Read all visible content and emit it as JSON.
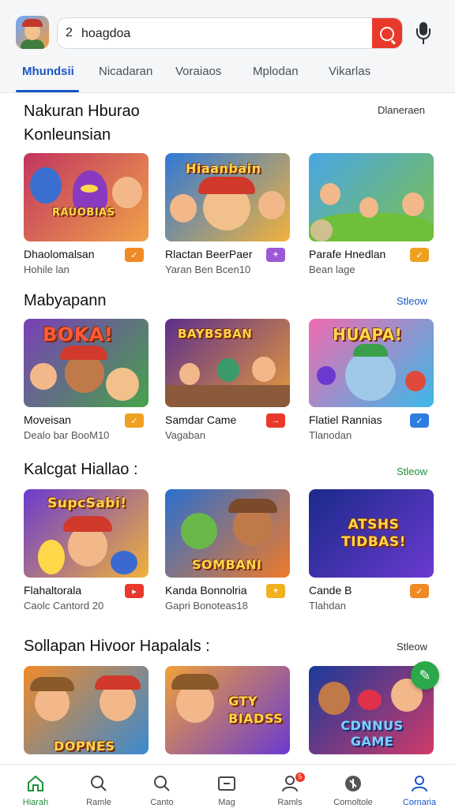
{
  "header": {
    "search": {
      "prefix": "2",
      "value": "hoagdoa"
    },
    "tabs": [
      {
        "label": "Mhundsii",
        "active": true
      },
      {
        "label": "Nicadaran"
      },
      {
        "label": "Voraiaos"
      },
      {
        "label": "Mplodan"
      },
      {
        "label": "Vikarlas"
      }
    ]
  },
  "sections": [
    {
      "title_line1": "Nakuran Hburao",
      "title_line2": "Konleunsian",
      "link": "Dlaneraen",
      "link_color": "#333333",
      "cards": [
        {
          "name": "Dhaolomalsan",
          "sub": "Hohile lan",
          "thumb_text": "RAUOBIAS",
          "badge": "✓",
          "badge_color": "#f08a24",
          "bg1": "#c2355f",
          "bg2": "#f0a24a"
        },
        {
          "name": "Rlactan BeerPaer",
          "sub": "Yaran Ben Bcen10",
          "thumb_text": "Hiaanbain",
          "badge": "+",
          "badge_color": "#9b59d6",
          "bg1": "#2f79d8",
          "bg2": "#f2b23b"
        },
        {
          "name": "Parafe Hnedlan",
          "sub": "Bean lage",
          "thumb_text": "",
          "badge": "✓",
          "badge_color": "#f0a020",
          "bg1": "#49a6e6",
          "bg2": "#7cc04a"
        }
      ]
    },
    {
      "title_line1": "Mabyapann",
      "link": "Stleow",
      "link_color": "#1a56c7",
      "cards": [
        {
          "name": "Moveisan",
          "sub": "Dealo bar BooM10",
          "thumb_text": "BOKA!",
          "badge": "✓",
          "badge_color": "#f0a020",
          "bg1": "#7a3fb8",
          "bg2": "#46a34a"
        },
        {
          "name": "Samdar Came",
          "sub": "Vagaban",
          "thumb_text": "BAYBSBAN",
          "badge": "→",
          "badge_color": "#e9392b",
          "bg1": "#5c2f8c",
          "bg2": "#e89a3a"
        },
        {
          "name": "Flatiel Rannias",
          "sub": "Tlanodan",
          "thumb_text": "HUAPA!",
          "badge": "✓",
          "badge_color": "#2d7de0",
          "bg1": "#f06bb0",
          "bg2": "#3cb8e8"
        }
      ]
    },
    {
      "title_line1": "Kalcgat Hiallao :",
      "link": "Stleow",
      "link_color": "#1f8f3a",
      "cards": [
        {
          "name": "Flahaltorala",
          "sub": "Caolc Cantord 20",
          "thumb_text": "SupcSabi!",
          "badge": "▸",
          "badge_color": "#e9392b",
          "bg1": "#6a3ad0",
          "bg2": "#f0b23a"
        },
        {
          "name": "Kanda Bonnolria",
          "sub": "Gapri Bonoteas18",
          "thumb_text": "SOMBANI",
          "badge": "+",
          "badge_color": "#f0b020",
          "bg1": "#2a6fd0",
          "bg2": "#f07a2a"
        },
        {
          "name": "Cande B",
          "sub": "Tlahdan",
          "thumb_text": "ATSHS TIDBAS!",
          "badge": "✓",
          "badge_color": "#f08a24",
          "bg1": "#1a2a8a",
          "bg2": "#6a3ad0"
        }
      ]
    },
    {
      "title_line1": "Sollapan Hivoor Hapalals :",
      "link": "Stleow",
      "link_color": "#333333",
      "cards": [
        {
          "name": "",
          "sub": "",
          "thumb_text": "DOPNES",
          "badge": "",
          "bg1": "#f08a2a",
          "bg2": "#3a8ad0"
        },
        {
          "name": "",
          "sub": "",
          "thumb_text": "GTY BIADSS",
          "badge": "",
          "bg1": "#f0a03a",
          "bg2": "#6a3ad0"
        },
        {
          "name": "",
          "sub": "",
          "thumb_text": "CDNNUS GAME",
          "badge": "",
          "bg1": "#1a3a9a",
          "bg2": "#d03a6a"
        }
      ]
    }
  ],
  "bottom_nav": [
    {
      "label": "Hiarah",
      "icon": "home-icon",
      "active": true
    },
    {
      "label": "Ramle",
      "icon": "search-icon"
    },
    {
      "label": "Canto",
      "icon": "search-icon"
    },
    {
      "label": "Mag",
      "icon": "tv-icon"
    },
    {
      "label": "Ramls",
      "icon": "profile-icon",
      "badge": "5"
    },
    {
      "label": "Comoltole",
      "icon": "globe-icon"
    },
    {
      "label": "Cornaria",
      "icon": "account-icon",
      "active2": true
    }
  ],
  "colors": {
    "accent_blue": "#1a56c7",
    "accent_green": "#1f8f3a",
    "search_red": "#e9392b"
  }
}
